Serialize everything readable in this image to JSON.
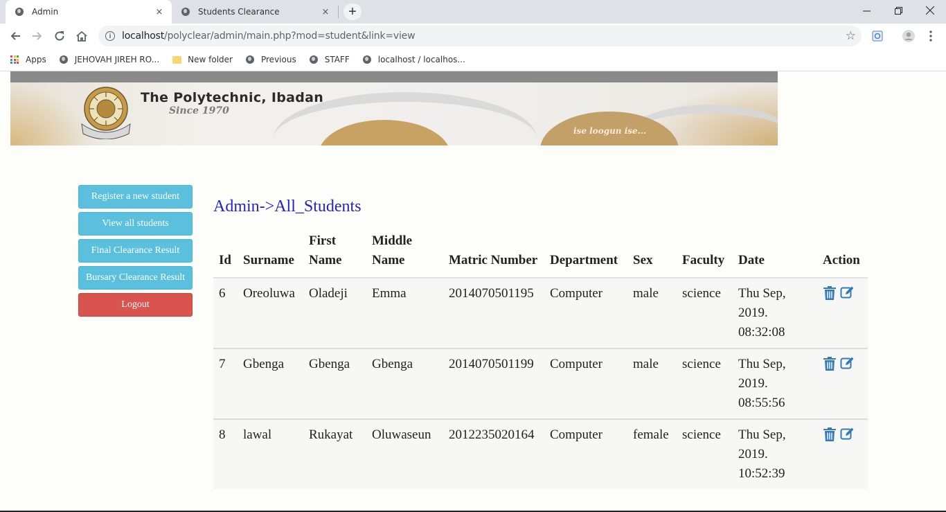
{
  "browser": {
    "tabs": [
      {
        "title": "Admin",
        "active": true
      },
      {
        "title": "Students Clearance",
        "active": false
      }
    ],
    "new_tab_label": "+",
    "close_glyph": "×",
    "url_host": "localhost",
    "url_path": "/polyclear/admin/main.php?mod=student&link=view",
    "window_controls": {
      "minimize": "—",
      "maximize": "❐",
      "close": "✕"
    },
    "bookmarks": [
      {
        "label": "Apps",
        "icon": "apps-grid-icon"
      },
      {
        "label": "JEHOVAH JIREH RO...",
        "icon": "globe-icon"
      },
      {
        "label": "New folder",
        "icon": "folder-icon"
      },
      {
        "label": "Previous",
        "icon": "globe-icon"
      },
      {
        "label": "STAFF",
        "icon": "globe-icon"
      },
      {
        "label": "localhost / localhos...",
        "icon": "globe-icon"
      }
    ]
  },
  "banner": {
    "title": "The Polytechnic, Ibadan",
    "since": "Since 1970",
    "motto": "ise loogun ise..."
  },
  "sidebar": {
    "buttons": [
      {
        "label": "Register a new student",
        "style": "info"
      },
      {
        "label": "View all students",
        "style": "info"
      },
      {
        "label": "Final Clearance Result",
        "style": "info"
      },
      {
        "label": "Bursary Clearance Result",
        "style": "info"
      },
      {
        "label": "Logout",
        "style": "danger"
      }
    ]
  },
  "main": {
    "heading": "Admin->All_Students",
    "table": {
      "headers": [
        "Id",
        "Surname",
        "First Name",
        "Middle Name",
        "Matric Number",
        "Department",
        "Sex",
        "Faculty",
        "Date",
        "Action"
      ],
      "rows": [
        {
          "id": "6",
          "surname": "Oreoluwa",
          "first": "Oladeji",
          "middle": "Emma",
          "matric": "2014070501195",
          "dept": "Computer",
          "sex": "male",
          "faculty": "science",
          "date": "Thu Sep, 2019. 08:32:08"
        },
        {
          "id": "7",
          "surname": "Gbenga",
          "first": "Gbenga",
          "middle": "Gbenga",
          "matric": "2014070501199",
          "dept": "Computer",
          "sex": "male",
          "faculty": "science",
          "date": "Thu Sep, 2019. 08:55:56"
        },
        {
          "id": "8",
          "surname": "lawal",
          "first": "Rukayat",
          "middle": "Oluwaseun",
          "matric": "2012235020164",
          "dept": "Computer",
          "sex": "female",
          "faculty": "science",
          "date": "Thu Sep, 2019. 10:52:39"
        }
      ]
    }
  },
  "colors": {
    "info_button": "#5bc0de",
    "danger_button": "#d9534f",
    "heading": "#2222cc",
    "action_icon": "#337ab7"
  }
}
